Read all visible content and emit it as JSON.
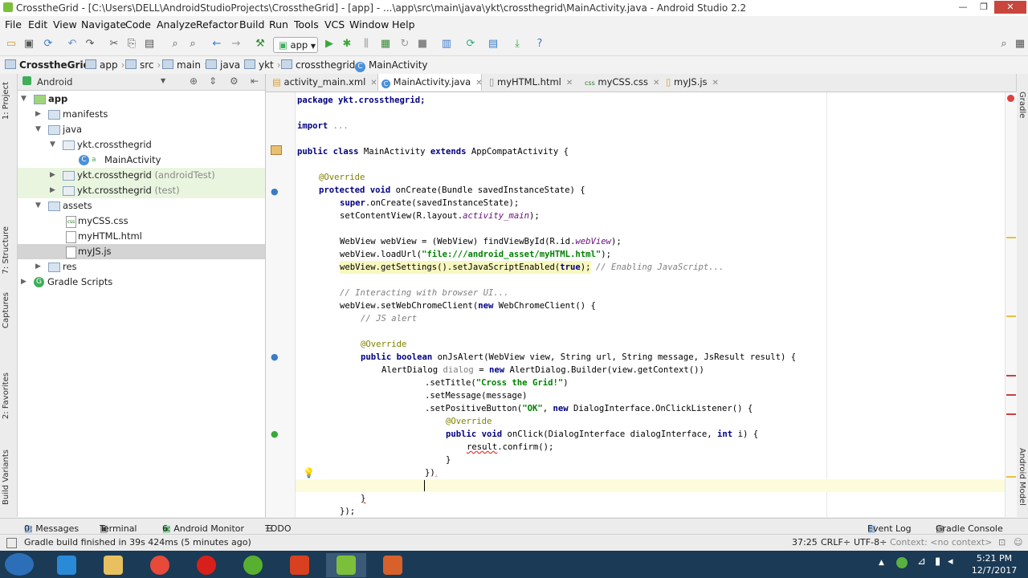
{
  "window": {
    "title": "CrosstheGrid - [C:\\Users\\DELL\\AndroidStudioProjects\\CrosstheGrid] - [app] - ...\\app\\src\\main\\java\\ykt\\crossthegrid\\MainActivity.java - Android Studio 2.2",
    "minimize": "—",
    "maximize": "❐",
    "close": "✕"
  },
  "menu": [
    "File",
    "Edit",
    "View",
    "Navigate",
    "Code",
    "Analyze",
    "Refactor",
    "Build",
    "Run",
    "Tools",
    "VCS",
    "Window",
    "Help"
  ],
  "toolbar": {
    "run_config": "app"
  },
  "breadcrumb": [
    "CrosstheGrid",
    "app",
    "src",
    "main",
    "java",
    "ykt",
    "crossthegrid",
    "MainActivity"
  ],
  "left_tabs": [
    "1: Project",
    "7: Structure",
    "Captures",
    "2: Favorites",
    "Build Variants"
  ],
  "right_tabs": [
    "Gradle",
    "Android Model"
  ],
  "project": {
    "view": "Android",
    "tree": [
      {
        "label": "app",
        "sub": ""
      },
      {
        "label": "manifests",
        "sub": ""
      },
      {
        "label": "java",
        "sub": ""
      },
      {
        "label": "ykt.crossthegrid",
        "sub": ""
      },
      {
        "label": "MainActivity",
        "sub": ""
      },
      {
        "label": "ykt.crossthegrid",
        "sub": "(androidTest)"
      },
      {
        "label": "ykt.crossthegrid",
        "sub": "(test)"
      },
      {
        "label": "assets",
        "sub": ""
      },
      {
        "label": "myCSS.css",
        "sub": ""
      },
      {
        "label": "myHTML.html",
        "sub": ""
      },
      {
        "label": "myJS.js",
        "sub": ""
      },
      {
        "label": "res",
        "sub": ""
      },
      {
        "label": "Gradle Scripts",
        "sub": ""
      }
    ]
  },
  "tabs": [
    {
      "label": "activity_main.xml"
    },
    {
      "label": "MainActivity.java"
    },
    {
      "label": "myHTML.html"
    },
    {
      "label": "myCSS.css"
    },
    {
      "label": "myJS.js"
    }
  ],
  "code": {
    "l1": [
      "package ykt.crossthegrid;"
    ],
    "l2": [
      "import ..."
    ],
    "l3": [
      "public class ",
      "MainActivity ",
      "extends ",
      "AppCompatActivity {"
    ],
    "l4": [
      "@Override"
    ],
    "l5": [
      "protected void ",
      "onCreate(Bundle savedInstanceState) {"
    ],
    "l6": [
      "super",
      ".onCreate(savedInstanceState);"
    ],
    "l7": [
      "setContentView(R.layout.",
      "activity_main",
      ");"
    ],
    "l8": [
      "WebView webView = (WebView) findViewById(R.id.",
      "webView",
      ");"
    ],
    "l9": [
      "webView.loadUrl(",
      "\"file:///android_asset/myHTML.html\"",
      ");"
    ],
    "l10": [
      "webView.getSettings().setJavaScriptEnabled(",
      "true",
      "); ",
      "// Enabling JavaScript..."
    ],
    "l11": [
      "// Interacting with browser UI..."
    ],
    "l12": [
      "webView.setWebChromeClient(",
      "new ",
      "WebChromeClient() {"
    ],
    "l13": [
      "// JS alert"
    ],
    "l14": [
      "@Override"
    ],
    "l15": [
      "public boolean ",
      "onJsAlert(WebView view, String url, String message, JsResult result) {"
    ],
    "l16": [
      "AlertDialog ",
      "dialog",
      " = ",
      "new ",
      "AlertDialog.Builder(view.getContext())"
    ],
    "l17": [
      ".setTitle(",
      "\"Cross the Grid!\"",
      ")"
    ],
    "l18": [
      ".setMessage(message)"
    ],
    "l19": [
      ".setPositiveButton(",
      "\"OK\"",
      ", ",
      "new ",
      "DialogInterface.OnClickListener() {"
    ],
    "l20": [
      "@Override"
    ],
    "l21": [
      "public void ",
      "onClick(DialogInterface dialogInterface, ",
      "int ",
      "i) {"
    ],
    "l22": [
      "result",
      ".confirm();"
    ],
    "l23": [
      "}"
    ],
    "l24": [
      "})"
    ],
    "l25": [
      "}"
    ],
    "l26": [
      "});"
    ]
  },
  "bottom_tools": [
    "0: Messages",
    "Terminal",
    "6: Android Monitor",
    "TODO",
    "Event Log",
    "Gradle Console"
  ],
  "status": {
    "message": "Gradle build finished in 39s 424ms (5 minutes ago)",
    "position": "37:25",
    "line_sep": "CRLF÷",
    "encoding": "UTF-8÷",
    "context": "Context: <no context>"
  },
  "taskbar": {
    "time": "5:21 PM",
    "date": "12/7/2017"
  }
}
